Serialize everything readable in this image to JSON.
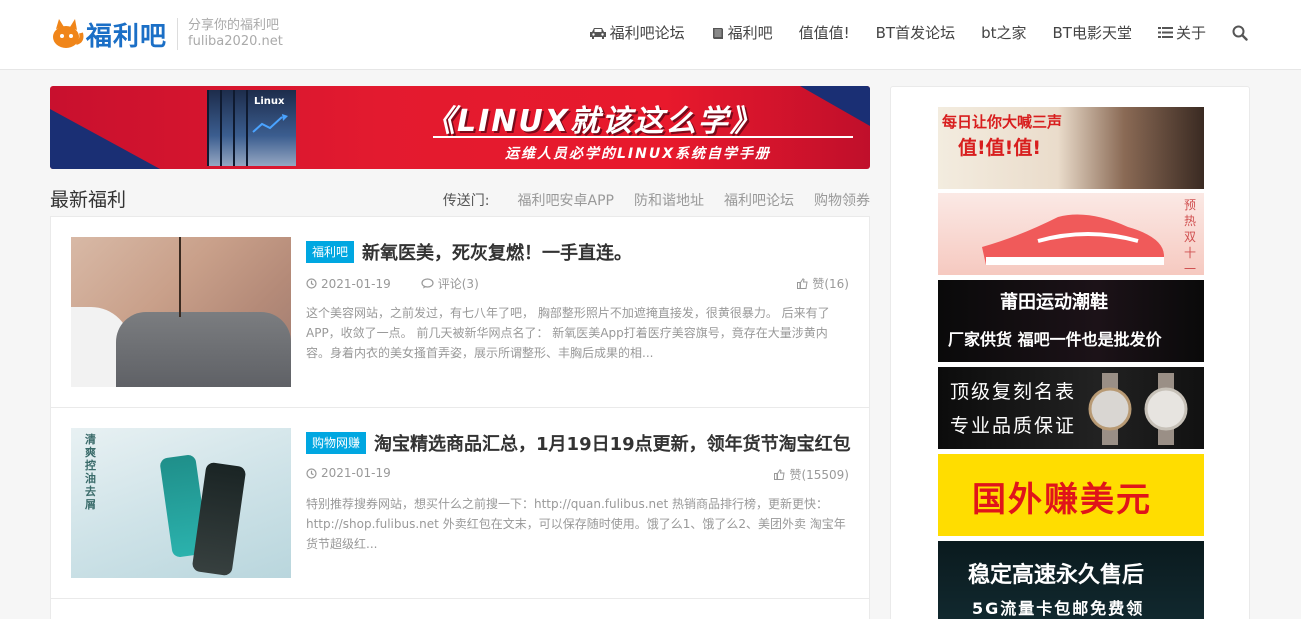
{
  "header": {
    "logo_text": "福利吧",
    "tagline": "分享你的福利吧",
    "domain": "fuliba2020.net",
    "nav": [
      {
        "label": "福利吧论坛",
        "icon": "car-icon"
      },
      {
        "label": "福利吧",
        "icon": "book-icon"
      },
      {
        "label": "值值值!",
        "icon": ""
      },
      {
        "label": "BT首发论坛",
        "icon": ""
      },
      {
        "label": "bt之家",
        "icon": ""
      },
      {
        "label": "BT电影天堂",
        "icon": ""
      },
      {
        "label": "关于",
        "icon": "list-icon"
      }
    ],
    "search_icon": "search-icon"
  },
  "banner": {
    "title": "《LINUX就该这么学》",
    "subtitle": "运维人员必学的LINUX系统自学手册",
    "book_label": "Linux"
  },
  "section": {
    "title": "最新福利",
    "portal_label": "传送门:",
    "portal_links": [
      "福利吧安卓APP",
      "防和谐地址",
      "福利吧论坛",
      "购物领券"
    ]
  },
  "posts": [
    {
      "category": "福利吧",
      "title": "新氧医美，死灰复燃！一手直连。",
      "date": "2021-01-19",
      "comments": "评论(3)",
      "likes": "赞(16)",
      "excerpt": "这个美容网站，之前发过，有七八年了吧， 胸部整形照片不加遮掩直接发，很黄很暴力。 后来有了APP，收敛了一点。 前几天被新华网点名了： 新氧医美App打着医疗美容旗号，竟存在大量涉黄内容。身着内衣的美女搔首弄姿，展示所谓整形、丰胸后成果的相..."
    },
    {
      "category": "购物网赚",
      "title": "淘宝精选商品汇总，1月19日19点更新，领年货节淘宝红包",
      "date": "2021-01-19",
      "comments": "",
      "likes": "赞(15509)",
      "excerpt": "特别推荐搜券网站，想买什么之前搜一下：http://quan.fulibus.net 热销商品排行榜，更新更快：http://shop.fulibus.net 外卖红包在文末，可以保存随时使用。饿了么1、饿了么2、美团外卖 淘宝年货节超级红...",
      "thumb_text": "清爽控油去屑"
    }
  ],
  "sidebar_ads": [
    {
      "line1": "每日让你大喊三声",
      "line2": "值!值!值!"
    },
    {
      "line1": "预热双十一"
    },
    {
      "line1": "莆田运动潮鞋",
      "line2": "厂家供货 福吧一件也是批发价"
    },
    {
      "line1": "顶级复刻名表",
      "line2": "专业品质保证"
    },
    {
      "line1": "国外赚美元"
    },
    {
      "line1": "稳定高速永久售后",
      "line2": "5G流量卡包邮免费领"
    }
  ],
  "colors": {
    "accent": "#00a7e1",
    "logo_blue": "#1b6fc6",
    "logo_orange": "#f08519",
    "banner_red": "#e31a2f"
  }
}
